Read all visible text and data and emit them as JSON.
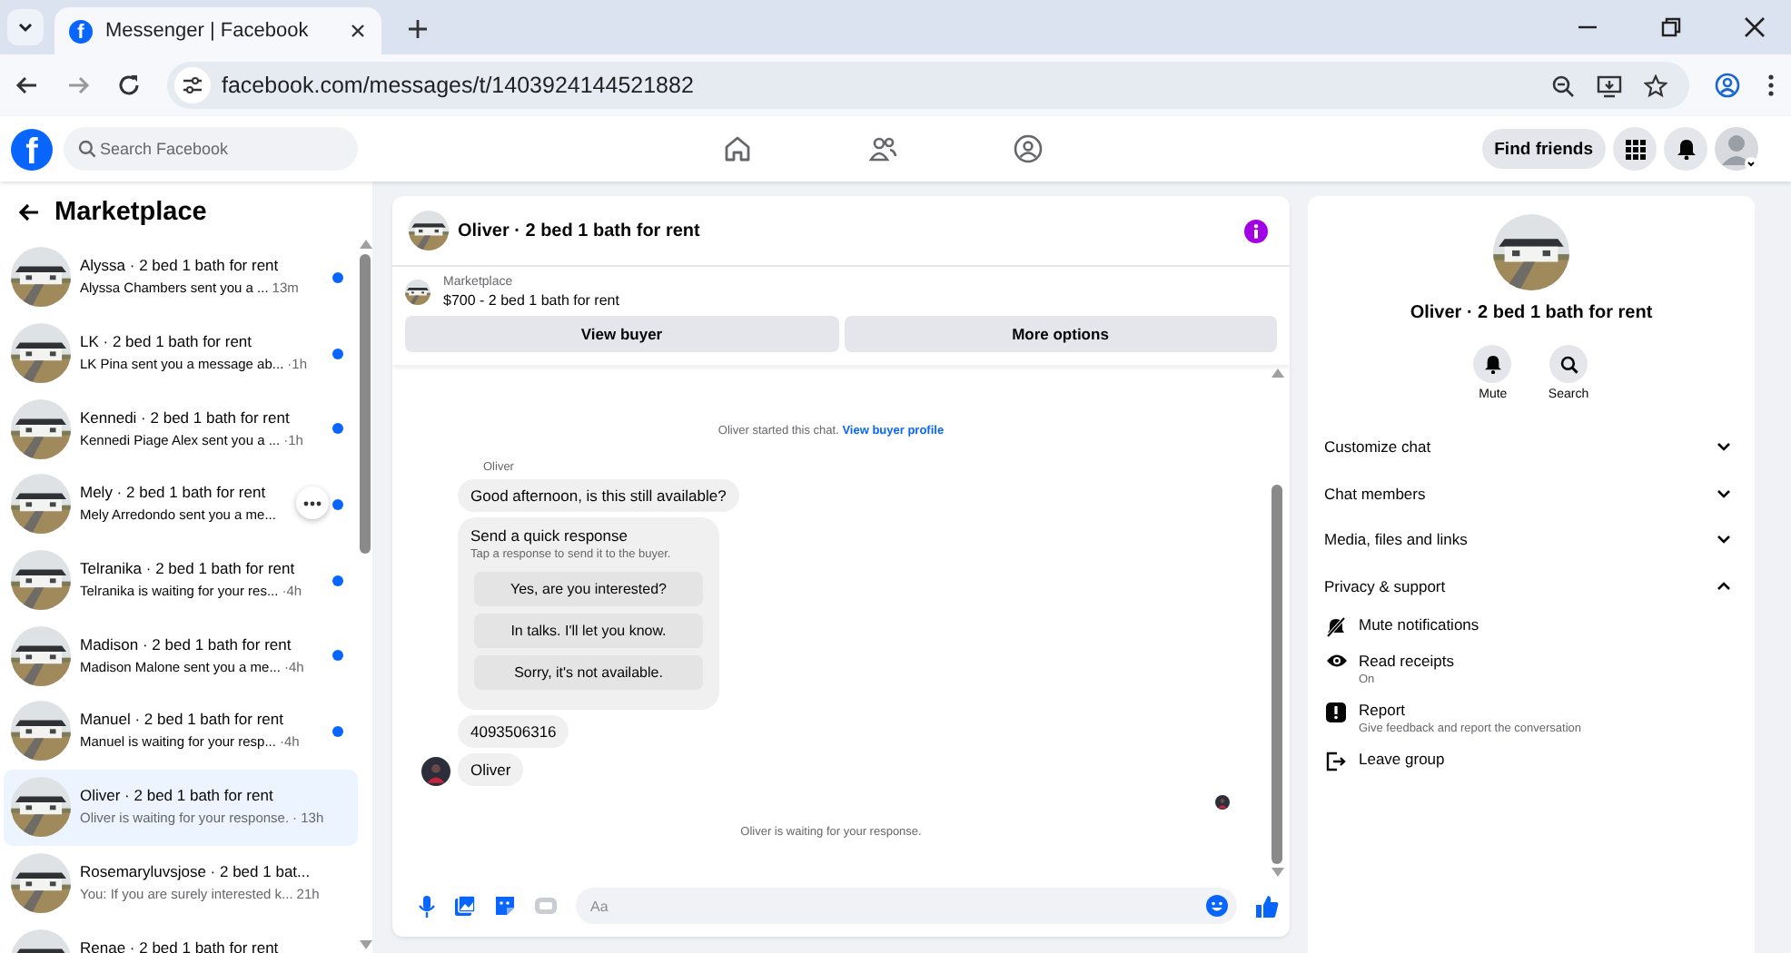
{
  "browser": {
    "tab": {
      "icon_letter": "f",
      "title": "Messenger | Facebook"
    },
    "url": "facebook.com/messages/t/1403924144521882"
  },
  "header": {
    "logo": "f",
    "search": {
      "placeholder": "Search Facebook"
    },
    "nav": [
      {
        "kind": "home"
      },
      {
        "kind": "friends"
      },
      {
        "kind": "groups"
      }
    ],
    "find_friends": "Find friends"
  },
  "sidebar": {
    "title": "Marketplace",
    "conversations": [
      {
        "title": "Alyssa · 2 bed 1 bath for rent",
        "preview": "Alyssa Chambers sent you a ...",
        "time": "13m",
        "unread": true,
        "selected": false,
        "hovered": false
      },
      {
        "title": "LK · 2 bed 1 bath for rent",
        "preview": "LK Pina sent you a message ab...",
        "time": "·1h",
        "unread": true,
        "selected": false,
        "hovered": false
      },
      {
        "title": "Kennedi · 2 bed 1 bath for rent",
        "preview": "Kennedi Piage Alex sent you a ...",
        "time": "·1h",
        "unread": true,
        "selected": false,
        "hovered": false
      },
      {
        "title": "Mely · 2 bed 1 bath for rent",
        "preview": "Mely Arredondo sent you a me...",
        "unread": true,
        "selected": false,
        "hovered": true
      },
      {
        "title": "Telranika · 2 bed 1 bath for rent",
        "preview": "Telranika is waiting for your res...",
        "time": "·4h",
        "unread": true,
        "selected": false,
        "hovered": false
      },
      {
        "title": "Madison · 2 bed 1 bath for rent",
        "preview": "Madison Malone sent you a me...",
        "time": "·4h",
        "unread": true,
        "selected": false,
        "hovered": false
      },
      {
        "title": "Manuel · 2 bed 1 bath for rent",
        "preview": "Manuel is waiting for your resp...",
        "time": "·4h",
        "unread": true,
        "selected": false,
        "hovered": false
      },
      {
        "title": "Oliver · 2 bed 1 bath for rent",
        "preview": "Oliver is waiting for your response.",
        "time": "· 13h",
        "unread": false,
        "selected": true,
        "hovered": false
      },
      {
        "title": "Rosemaryluvsjose · 2 bed 1 bat...",
        "preview": "You: If you are surely interested k...",
        "time": "21h",
        "unread": false,
        "selected": false,
        "hovered": false
      },
      {
        "title": "Renae · 2 bed 1 bath for rent",
        "selected": false,
        "hovered": false
      }
    ]
  },
  "chat": {
    "title": "Oliver · 2 bed 1 bath for rent",
    "listing": {
      "source": "Marketplace",
      "name": "$700 - 2 bed 1 bath for rent"
    },
    "actions": [
      "View buyer",
      "More options"
    ],
    "started": {
      "text": "Oliver started this chat.",
      "link": "View buyer profile"
    },
    "sender": "Oliver",
    "messages": [
      {
        "kind": "text",
        "text": "Good afternoon, is this still available?",
        "avatar": false
      },
      {
        "kind": "quick",
        "title": "Send a quick response",
        "subtitle": "Tap a response to send it to the buyer.",
        "options": [
          "Yes, are you interested?",
          "In talks. I'll let you know.",
          "Sorry, it's not available."
        ],
        "avatar": false
      },
      {
        "kind": "text",
        "text": "4093506316",
        "avatar": false
      },
      {
        "kind": "text",
        "text": "Oliver",
        "avatar": true
      }
    ],
    "status": "Oliver is waiting for your response.",
    "composer": {
      "placeholder": "Aa"
    }
  },
  "details": {
    "title": "Oliver · 2 bed 1 bath for rent",
    "actions": [
      {
        "kind": "mute",
        "label": "Mute"
      },
      {
        "kind": "search",
        "label": "Search"
      }
    ],
    "sections": [
      {
        "label": "Customize chat",
        "expanded": false
      },
      {
        "label": "Chat members",
        "expanded": false
      },
      {
        "label": "Media, files and links",
        "expanded": false
      },
      {
        "label": "Privacy & support",
        "expanded": true,
        "items": [
          {
            "kind": "mute",
            "label": "Mute notifications"
          },
          {
            "kind": "eye",
            "label": "Read receipts",
            "detail": "On"
          },
          {
            "kind": "report",
            "label": "Report",
            "detail": "Give feedback and report the conversation"
          },
          {
            "kind": "leave",
            "label": "Leave group"
          }
        ]
      }
    ]
  }
}
